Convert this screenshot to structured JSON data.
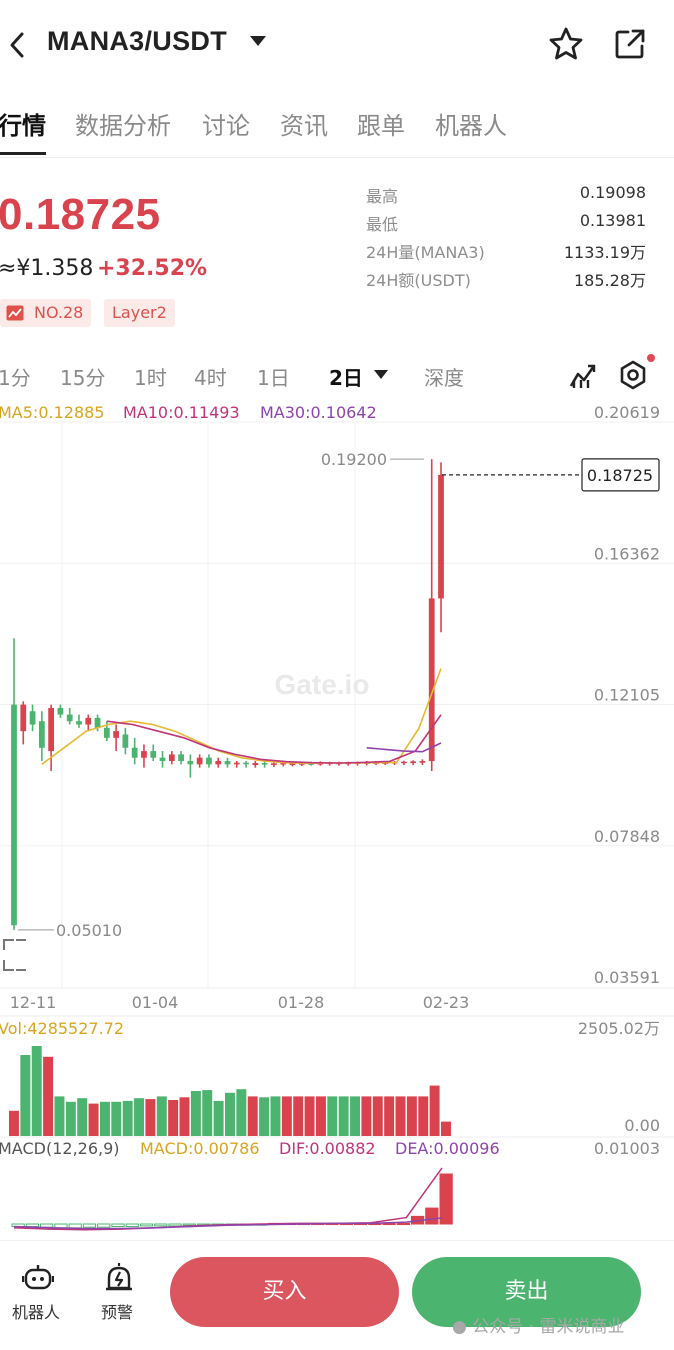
{
  "header": {
    "pair": "MANA3/USDT"
  },
  "tabs": [
    {
      "label": "行情",
      "active": true
    },
    {
      "label": "数据分析"
    },
    {
      "label": "讨论"
    },
    {
      "label": "资讯"
    },
    {
      "label": "跟单"
    },
    {
      "label": "机器人"
    }
  ],
  "ticker": {
    "price": "0.18725",
    "cny": "≈¥1.358",
    "change": "+32.52%",
    "rank": "NO.28",
    "tag": "Layer2"
  },
  "stats": [
    {
      "label": "最高",
      "value": "0.19098"
    },
    {
      "label": "最低",
      "value": "0.13981"
    },
    {
      "label": "24H量(MANA3)",
      "value": "1133.19万"
    },
    {
      "label": "24H额(USDT)",
      "value": "185.28万"
    }
  ],
  "timeframes": [
    "1分",
    "15分",
    "1时",
    "4时",
    "1日",
    "2日",
    "深度"
  ],
  "active_timeframe": "2日",
  "indicators": {
    "ma5": "MA5:0.12885",
    "ma10": "MA10:0.11493",
    "ma30": "MA30:0.10642",
    "vol": "Vol:4285527.72",
    "macd_params": "MACD(12,26,9)",
    "macd": "MACD:0.00786",
    "dif": "DIF:0.00882",
    "dea": "DEA:0.00096"
  },
  "chart_data": {
    "type": "candlestick",
    "price_axis": [
      "0.20619",
      "0.16362",
      "0.12105",
      "0.07848",
      "0.03591"
    ],
    "high_label": "0.19200",
    "low_label": "0.05010",
    "last_price": "0.18725",
    "dates": [
      "12-11",
      "01-04",
      "01-28",
      "02-23"
    ],
    "volume_axis": [
      "2505.02万",
      "0.00"
    ],
    "macd_axis": [
      "0.01003"
    ],
    "watermark": "Gate.io",
    "colors": {
      "up": "#d9434e",
      "down": "#4bb46f",
      "ma5": "#e8b830",
      "ma10": "#c0347a",
      "ma30": "#8e44ad"
    },
    "candles": [
      {
        "o": 0.118,
        "h": 0.138,
        "l": 0.0501,
        "c": 0.0515
      },
      {
        "o": 0.11,
        "h": 0.119,
        "l": 0.106,
        "c": 0.118
      },
      {
        "o": 0.116,
        "h": 0.118,
        "l": 0.11,
        "c": 0.112
      },
      {
        "o": 0.113,
        "h": 0.116,
        "l": 0.101,
        "c": 0.105
      },
      {
        "o": 0.104,
        "h": 0.118,
        "l": 0.098,
        "c": 0.117
      },
      {
        "o": 0.117,
        "h": 0.118,
        "l": 0.114,
        "c": 0.115
      },
      {
        "o": 0.115,
        "h": 0.117,
        "l": 0.112,
        "c": 0.113
      },
      {
        "o": 0.113,
        "h": 0.115,
        "l": 0.111,
        "c": 0.112
      },
      {
        "o": 0.112,
        "h": 0.115,
        "l": 0.11,
        "c": 0.114
      },
      {
        "o": 0.114,
        "h": 0.115,
        "l": 0.11,
        "c": 0.111
      },
      {
        "o": 0.111,
        "h": 0.113,
        "l": 0.107,
        "c": 0.108
      },
      {
        "o": 0.108,
        "h": 0.112,
        "l": 0.104,
        "c": 0.11
      },
      {
        "o": 0.109,
        "h": 0.111,
        "l": 0.103,
        "c": 0.105
      },
      {
        "o": 0.105,
        "h": 0.108,
        "l": 0.1,
        "c": 0.102
      },
      {
        "o": 0.102,
        "h": 0.106,
        "l": 0.099,
        "c": 0.104
      },
      {
        "o": 0.104,
        "h": 0.106,
        "l": 0.101,
        "c": 0.102
      },
      {
        "o": 0.102,
        "h": 0.104,
        "l": 0.099,
        "c": 0.101
      },
      {
        "o": 0.101,
        "h": 0.104,
        "l": 0.1,
        "c": 0.103
      },
      {
        "o": 0.103,
        "h": 0.104,
        "l": 0.1,
        "c": 0.101
      },
      {
        "o": 0.101,
        "h": 0.103,
        "l": 0.096,
        "c": 0.1
      },
      {
        "o": 0.1,
        "h": 0.103,
        "l": 0.099,
        "c": 0.102
      },
      {
        "o": 0.102,
        "h": 0.103,
        "l": 0.099,
        "c": 0.1
      },
      {
        "o": 0.1,
        "h": 0.102,
        "l": 0.099,
        "c": 0.101
      },
      {
        "o": 0.101,
        "h": 0.102,
        "l": 0.099,
        "c": 0.1
      },
      {
        "o": 0.1,
        "h": 0.101,
        "l": 0.099,
        "c": 0.1005
      },
      {
        "o": 0.1005,
        "h": 0.101,
        "l": 0.099,
        "c": 0.1002
      },
      {
        "o": 0.0998,
        "h": 0.101,
        "l": 0.099,
        "c": 0.1004
      },
      {
        "o": 0.1004,
        "h": 0.101,
        "l": 0.099,
        "c": 0.1
      },
      {
        "o": 0.0998,
        "h": 0.1005,
        "l": 0.0992,
        "c": 0.1003
      },
      {
        "o": 0.1,
        "h": 0.1006,
        "l": 0.0994,
        "c": 0.1004
      },
      {
        "o": 0.0998,
        "h": 0.1006,
        "l": 0.0994,
        "c": 0.1004
      },
      {
        "o": 0.0999,
        "h": 0.1007,
        "l": 0.0995,
        "c": 0.1005
      },
      {
        "o": 0.1003,
        "h": 0.1008,
        "l": 0.0996,
        "c": 0.1
      },
      {
        "o": 0.1,
        "h": 0.1009,
        "l": 0.0996,
        "c": 0.1004
      },
      {
        "o": 0.1001,
        "h": 0.1008,
        "l": 0.0996,
        "c": 0.1005
      },
      {
        "o": 0.1001,
        "h": 0.1008,
        "l": 0.0996,
        "c": 0.1005
      },
      {
        "o": 0.1002,
        "h": 0.1008,
        "l": 0.0996,
        "c": 0.1005
      },
      {
        "o": 0.1002,
        "h": 0.1008,
        "l": 0.0996,
        "c": 0.1006
      },
      {
        "o": 0.1002,
        "h": 0.101,
        "l": 0.0997,
        "c": 0.1006
      },
      {
        "o": 0.1003,
        "h": 0.101,
        "l": 0.0998,
        "c": 0.1006
      },
      {
        "o": 0.1003,
        "h": 0.101,
        "l": 0.0998,
        "c": 0.1006
      },
      {
        "o": 0.1004,
        "h": 0.101,
        "l": 0.0998,
        "c": 0.1007
      },
      {
        "o": 0.1004,
        "h": 0.1011,
        "l": 0.0998,
        "c": 0.1008
      },
      {
        "o": 0.1004,
        "h": 0.1012,
        "l": 0.0998,
        "c": 0.1009
      },
      {
        "o": 0.1005,
        "h": 0.1015,
        "l": 0.0998,
        "c": 0.101
      },
      {
        "o": 0.101,
        "h": 0.192,
        "l": 0.098,
        "c": 0.15
      },
      {
        "o": 0.15,
        "h": 0.191,
        "l": 0.1398,
        "c": 0.18725
      }
    ],
    "ma5": [
      0.1,
      0.105,
      0.11,
      0.112,
      0.113,
      0.112,
      0.11,
      0.107,
      0.104,
      0.102,
      0.101,
      0.1005,
      0.1003,
      0.1004,
      0.1004,
      0.1005,
      0.1006,
      0.1108,
      0.12885
    ],
    "ma10": [
      0.113,
      0.112,
      0.11,
      0.108,
      0.105,
      0.103,
      0.1015,
      0.1008,
      0.1005,
      0.1004,
      0.1006,
      0.1009,
      0.104,
      0.11493
    ],
    "ma30": [
      0.105,
      0.1045,
      0.104,
      0.1038,
      0.10642
    ],
    "volume": [
      {
        "v": 280,
        "up": true
      },
      {
        "v": 900,
        "up": false
      },
      {
        "v": 1000,
        "up": false
      },
      {
        "v": 880,
        "up": true
      },
      {
        "v": 440,
        "up": false
      },
      {
        "v": 380,
        "up": false
      },
      {
        "v": 420,
        "up": false
      },
      {
        "v": 360,
        "up": true
      },
      {
        "v": 380,
        "up": false
      },
      {
        "v": 380,
        "up": false
      },
      {
        "v": 390,
        "up": false
      },
      {
        "v": 420,
        "up": false
      },
      {
        "v": 410,
        "up": true
      },
      {
        "v": 440,
        "up": false
      },
      {
        "v": 400,
        "up": true
      },
      {
        "v": 430,
        "up": true
      },
      {
        "v": 500,
        "up": false
      },
      {
        "v": 510,
        "up": false
      },
      {
        "v": 390,
        "up": false
      },
      {
        "v": 480,
        "up": false
      },
      {
        "v": 520,
        "up": false
      },
      {
        "v": 440,
        "up": true
      },
      {
        "v": 430,
        "up": false
      },
      {
        "v": 440,
        "up": false
      },
      {
        "v": 440,
        "up": true
      },
      {
        "v": 440,
        "up": true
      },
      {
        "v": 440,
        "up": true
      },
      {
        "v": 440,
        "up": true
      },
      {
        "v": 440,
        "up": false
      },
      {
        "v": 440,
        "up": false
      },
      {
        "v": 440,
        "up": false
      },
      {
        "v": 440,
        "up": true
      },
      {
        "v": 440,
        "up": true
      },
      {
        "v": 440,
        "up": true
      },
      {
        "v": 440,
        "up": true
      },
      {
        "v": 440,
        "up": true
      },
      {
        "v": 440,
        "up": true
      },
      {
        "v": 560,
        "up": true
      },
      {
        "v": 160,
        "up": true
      }
    ],
    "macd_hist": [
      -0.0004,
      -0.0004,
      -0.0005,
      -0.0006,
      -0.0006,
      -0.0005,
      -0.0005,
      -0.0004,
      -0.0004,
      -0.0003,
      -0.0003,
      -0.0003,
      -0.0002,
      -0.0002,
      -0.0002,
      -0.0001,
      -0.0001,
      -0.0001,
      0.0001,
      0.0001,
      0.0001,
      0.0001,
      0.0001,
      0.0001,
      0.0001,
      0.0001,
      0.0001,
      0.0001,
      0.0012,
      0.0025,
      0.00786
    ],
    "dif_series": [
      -0.0006,
      -0.0008,
      -0.0009,
      -0.0008,
      -0.0006,
      -0.0003,
      -0.0001,
      0.0,
      0.0001,
      0.0001,
      0.0002,
      0.001,
      0.00882
    ],
    "dea_series": [
      -0.0004,
      -0.0006,
      -0.0007,
      -0.0007,
      -0.0006,
      -0.0004,
      -0.0002,
      -0.0001,
      0.0,
      0.0001,
      0.0001,
      0.0003,
      0.00096
    ]
  },
  "bottom": {
    "robot": "机器人",
    "alert": "预警",
    "buy": "买入",
    "sell": "卖出",
    "watermark": "公众号 · 雷米说商业"
  }
}
